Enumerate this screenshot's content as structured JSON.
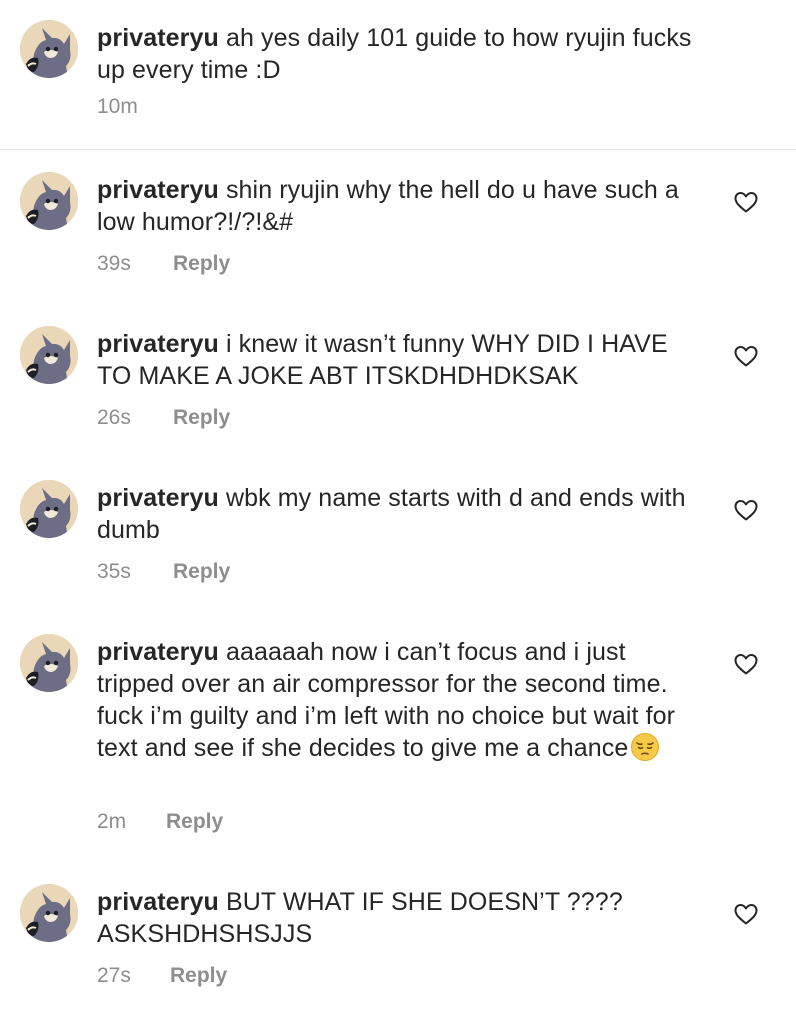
{
  "caption": {
    "username": "privateryu",
    "text": "ah yes daily 101 guide to how ryujin fucks up every time :D",
    "time": "10m"
  },
  "comments": [
    {
      "username": "privateryu",
      "text": "shin ryujin why the hell do u have such a low humor?!/?!&#",
      "time": "39s",
      "reply": "Reply"
    },
    {
      "username": "privateryu",
      "text": "i knew it wasn’t funny WHY DID I HAVE TO MAKE A JOKE ABT ITSKDHDHDKSAK",
      "time": "26s",
      "reply": "Reply"
    },
    {
      "username": "privateryu",
      "text": "wbk my name starts with d and ends with dumb",
      "time": "35s",
      "reply": "Reply"
    },
    {
      "username": "privateryu",
      "text": "aaaaaah now i can’t focus and i just tripped over an air compressor for the second time. fuck i’m guilty and i’m left with no choice but wait for text and see if she decides to give me a chance",
      "emoji": "pensive-face",
      "time": "2m",
      "reply": "Reply"
    },
    {
      "username": "privateryu",
      "text": "BUT WHAT IF SHE DOESN’T ???? ASKSHDHSHSJJS",
      "time": "27s",
      "reply": "Reply"
    }
  ],
  "icons": {
    "like": "heart-outline-icon",
    "avatar": "cartoon-cat-avatar"
  },
  "colors": {
    "text": "#262626",
    "secondary": "#8e8e8e",
    "divider": "#e6e6e6",
    "avatar_bg": "#e9d7b7"
  }
}
